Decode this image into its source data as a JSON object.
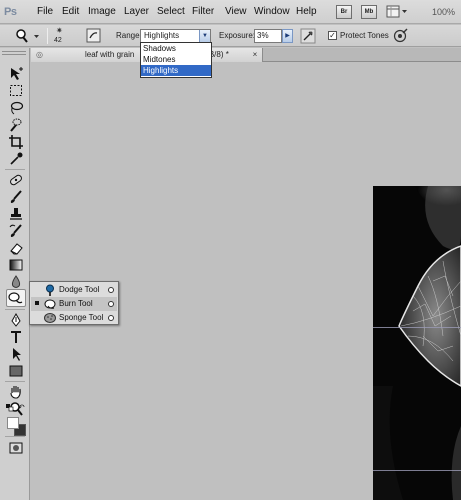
{
  "app": {
    "logo": "Ps",
    "menu": [
      "File",
      "Edit",
      "Image",
      "Layer",
      "Select",
      "Filter",
      "View",
      "Window",
      "Help"
    ],
    "bridge_button": "Br",
    "minibridge_button": "Mb",
    "zoom_level": "100%"
  },
  "options": {
    "brush_size": "42",
    "range_label": "Range:",
    "range_value": "Highlights",
    "range_options": [
      "Shadows",
      "Midtones",
      "Highlights"
    ],
    "exposure_label": "Exposure:",
    "exposure_value": "3%",
    "protect_tones_label": "Protect Tones",
    "protect_tones_checked": true
  },
  "document": {
    "tab_title_start": "leaf with grain",
    "tab_title_end": "RGB/8) *",
    "close_glyph": "×"
  },
  "flyout": {
    "items": [
      {
        "label": "Dodge Tool",
        "icon": "dodge-icon",
        "current": false
      },
      {
        "label": "Burn Tool",
        "icon": "burn-icon",
        "current": true
      },
      {
        "label": "Sponge Tool",
        "icon": "sponge-icon",
        "current": false
      }
    ]
  },
  "colors": {
    "accent_selection": "#3169c6",
    "foreground_color": "#ffffff",
    "background_color": "#333333"
  }
}
